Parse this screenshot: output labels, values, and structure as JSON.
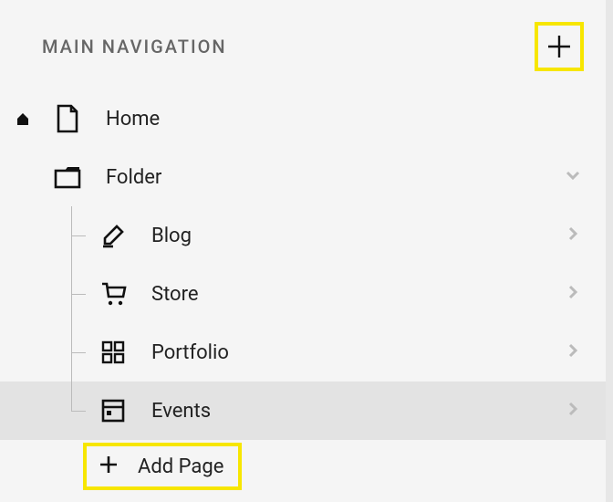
{
  "header": {
    "title": "MAIN NAVIGATION"
  },
  "nav": {
    "home": {
      "label": "Home"
    },
    "folder": {
      "label": "Folder"
    },
    "children": [
      {
        "label": "Blog"
      },
      {
        "label": "Store"
      },
      {
        "label": "Portfolio"
      },
      {
        "label": "Events"
      }
    ],
    "add_page": {
      "label": "Add Page"
    }
  },
  "colors": {
    "highlight": "#f7e600",
    "selected_bg": "#e3e3e3"
  }
}
